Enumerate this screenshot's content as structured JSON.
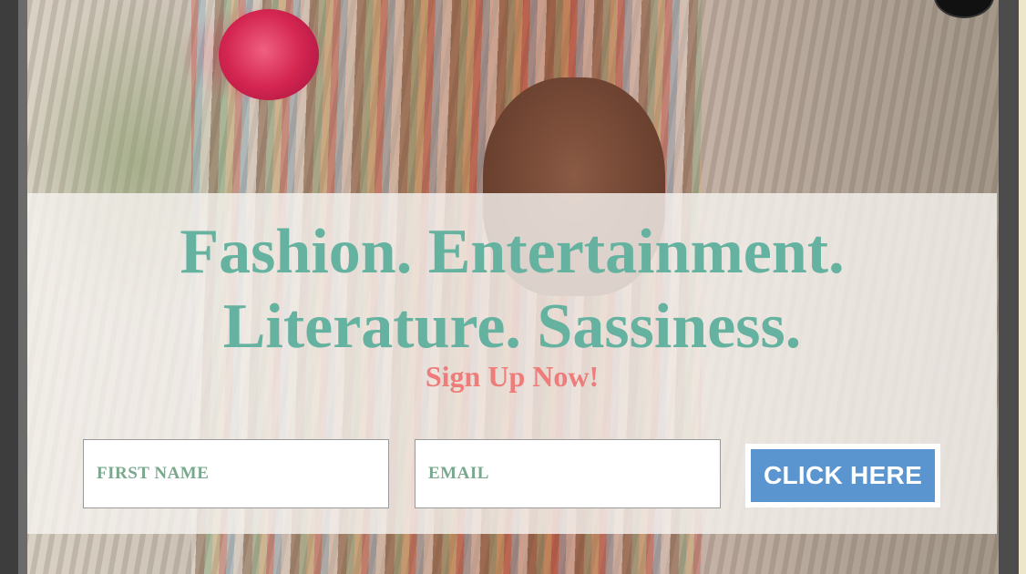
{
  "popup": {
    "headline": "Fashion. Entertainment. Literature. Sassiness.",
    "subheadline": "Sign Up Now!"
  },
  "form": {
    "first_name_placeholder": "FIRST NAME",
    "email_placeholder": "EMAIL",
    "submit_label": "CLICK HERE"
  },
  "colors": {
    "headline": "#66b2a0",
    "subheadline": "#ee7c7a",
    "placeholder": "#7aa88e",
    "button": "#5a95cf",
    "overlay": "#f5f2ee"
  },
  "icons": {
    "close": "close-icon"
  }
}
